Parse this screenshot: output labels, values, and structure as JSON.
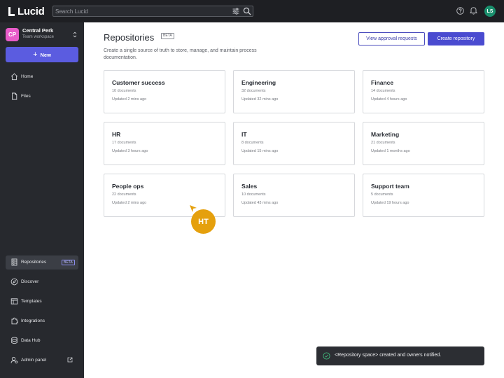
{
  "app": {
    "logo_text": "Lucid",
    "user_initials": "LS"
  },
  "search": {
    "placeholder": "Search Lucid"
  },
  "workspace": {
    "initials": "CP",
    "name": "Central Perk",
    "subtitle": "Team workspace"
  },
  "sidebar": {
    "new_label": "New",
    "top_items": [
      {
        "label": "Home",
        "icon": "home-icon"
      },
      {
        "label": "Files",
        "icon": "file-icon"
      }
    ],
    "bottom_items": [
      {
        "label": "Repositories",
        "icon": "repository-icon",
        "badge": "BETA",
        "active": true
      },
      {
        "label": "Discover",
        "icon": "compass-icon"
      },
      {
        "label": "Templates",
        "icon": "template-icon"
      },
      {
        "label": "Integrations",
        "icon": "puzzle-icon"
      },
      {
        "label": "Data Hub",
        "icon": "database-icon"
      },
      {
        "label": "Admin panel",
        "icon": "admin-icon",
        "external": true
      }
    ]
  },
  "main": {
    "title": "Repositories",
    "title_badge": "BETA",
    "description": "Create a single source of truth to store, manage, and maintain process documentation.",
    "view_approval_label": "View approval requests",
    "create_label": "Create repository",
    "repositories": [
      {
        "name": "Customer success",
        "documents": "10 documents",
        "updated": "Updated 2 mins ago"
      },
      {
        "name": "Engineering",
        "documents": "32 documents",
        "updated": "Updated 32 mins ago"
      },
      {
        "name": "Finance",
        "documents": "14 documents",
        "updated": "Updated 4 hours ago"
      },
      {
        "name": "HR",
        "documents": "17 documents",
        "updated": "Updated 3 hours ago"
      },
      {
        "name": "IT",
        "documents": "8 documents",
        "updated": "Updated 15 mins ago"
      },
      {
        "name": "Marketing",
        "documents": "21 documents",
        "updated": "Updated 1 months ago"
      },
      {
        "name": "People ops",
        "documents": "22 documents",
        "updated": "Updated 2 mins ago"
      },
      {
        "name": "Sales",
        "documents": "10 documents",
        "updated": "Updated 43 mins ago"
      },
      {
        "name": "Support team",
        "documents": "5 documents",
        "updated": "Updated 19 hours ago"
      }
    ]
  },
  "collaborator_cursor": {
    "initials": "HT",
    "color": "#e5a00d"
  },
  "toast": {
    "message": "<Repository space> created and owners notified."
  },
  "colors": {
    "accent": "#4a4bd0",
    "sidebar_bg": "#27292e",
    "topbar_bg": "#1e1f23",
    "workspace_badge": "#e85cc9",
    "user_avatar": "#1a8f6d"
  }
}
